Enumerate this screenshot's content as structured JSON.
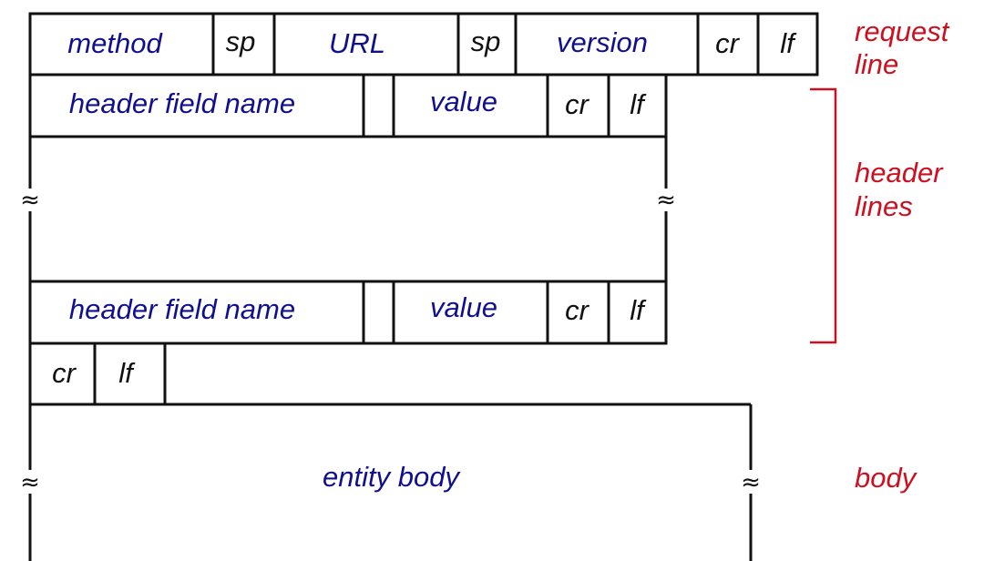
{
  "request_line": {
    "fields": [
      "method",
      "sp",
      "URL",
      "sp",
      "version",
      "cr",
      "lf"
    ],
    "label_line1": "request",
    "label_line2": "line"
  },
  "header_line": {
    "fields": [
      "header field name",
      "value",
      "cr",
      "lf"
    ]
  },
  "header_lines_label": {
    "line1": "header",
    "line2": "lines"
  },
  "blank_line": {
    "fields": [
      "cr",
      "lf"
    ]
  },
  "body": {
    "field": "entity body",
    "label": "body"
  },
  "break_symbol": "≈",
  "colors": {
    "field_text": "#10108f",
    "control_text": "#111111",
    "annotation": "#cc1020"
  }
}
